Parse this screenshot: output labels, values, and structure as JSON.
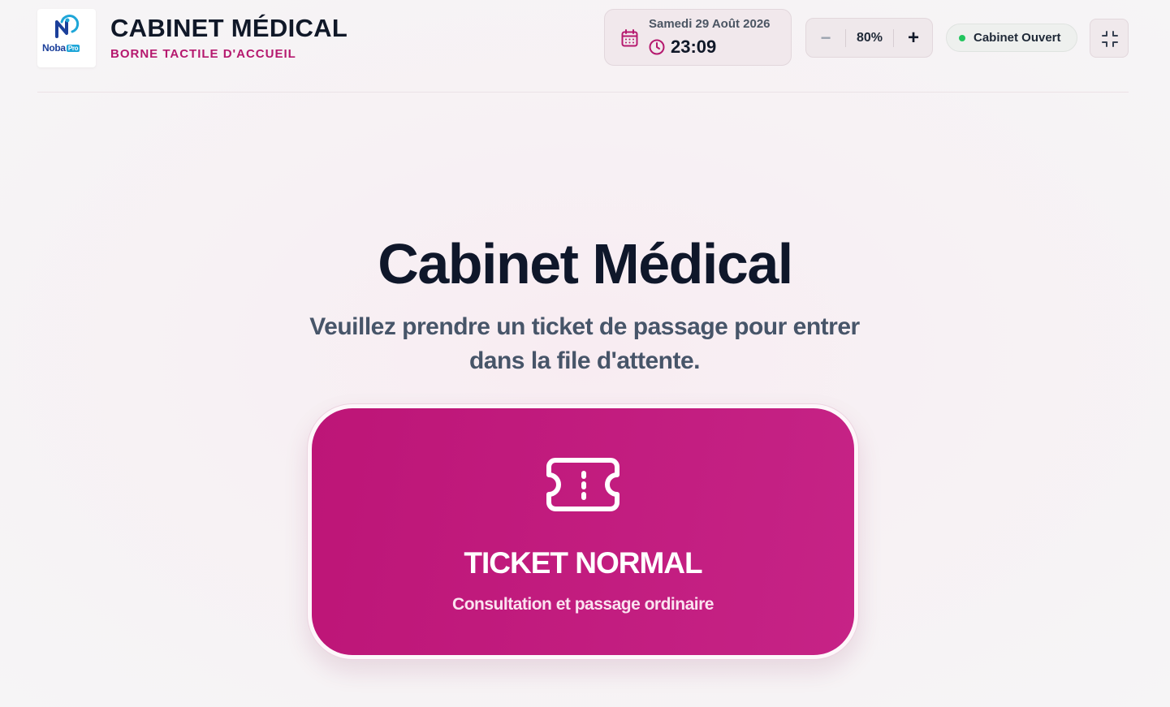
{
  "header": {
    "logo": {
      "brand": "Noba",
      "badge": "Pro"
    },
    "title": "CABINET MÉDICAL",
    "subtitle": "BORNE TACTILE D'ACCUEIL",
    "date": "Samedi 29 Août 2026",
    "time": "23:09",
    "zoom": {
      "minus_label": "−",
      "value": "80%",
      "plus_label": "+"
    },
    "status": {
      "label": "Cabinet Ouvert",
      "color": "#22c55e"
    },
    "fullscreen_icon": "minimize-icon"
  },
  "main": {
    "title": "Cabinet Médical",
    "instruction": "Veuillez prendre un ticket de passage pour entrer dans la file d'attente.",
    "ticket_button": {
      "icon": "ticket-icon",
      "title": "TICKET NORMAL",
      "description": "Consultation et passage ordinaire",
      "color": "#c2177b"
    }
  },
  "colors": {
    "accent": "#b5186e",
    "text_dark": "#101828"
  }
}
